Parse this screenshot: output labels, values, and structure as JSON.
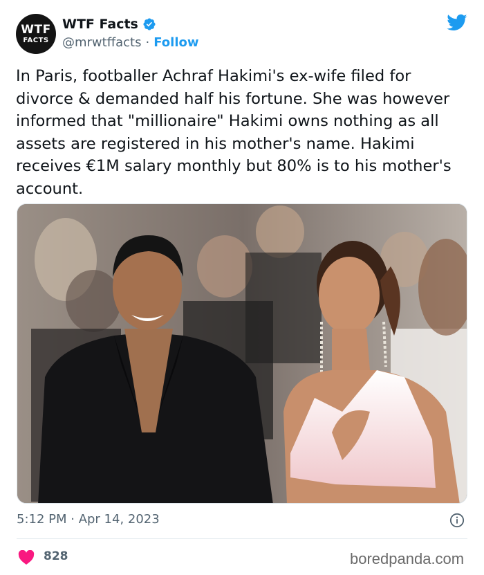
{
  "account": {
    "avatar_line1": "WTF",
    "avatar_line2": "FACTS",
    "display_name": "WTF Facts",
    "handle": "@mrwtffacts",
    "separator": "·",
    "follow_label": "Follow"
  },
  "tweet": {
    "text": "In Paris, footballer Achraf Hakimi's ex-wife filed for divorce & demanded half his fortune. She was however informed that \"millionaire\" Hakimi owns nothing as all assets are registered in his mother's name. Hakimi receives €1M salary monthly but 80% is to his mother's account.",
    "timestamp": "5:12 PM · Apr 14, 2023",
    "likes": "828"
  },
  "watermark": "boredpanda.com",
  "icons": {
    "verified": "verified-badge-icon",
    "platform": "twitter-bird-icon",
    "info": "info-icon",
    "like": "heart-icon"
  },
  "colors": {
    "brand_blue": "#1d9bf0",
    "heart": "#f91880",
    "muted_text": "#536471"
  }
}
